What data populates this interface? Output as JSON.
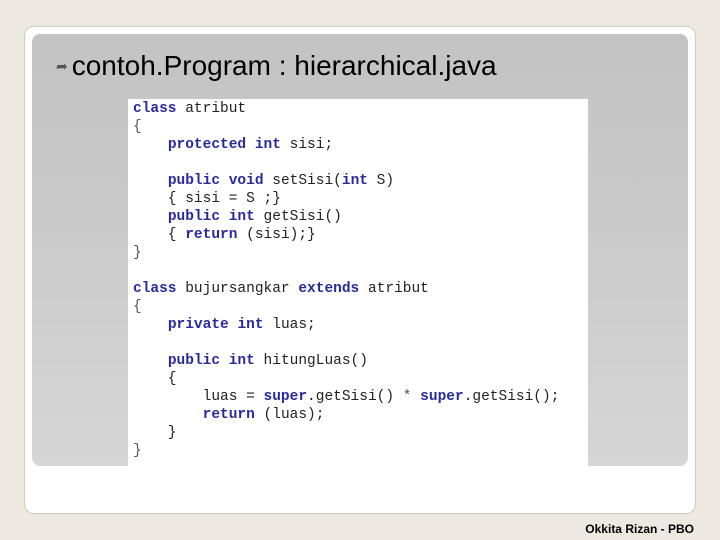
{
  "slide": {
    "title": "contoh.Program : hierarchical.java",
    "bullet_icon": "curved-arrow-bullet-icon",
    "footer": "Okkita Rizan - PBO"
  },
  "code_lines": [
    [
      [
        "kw",
        "class"
      ],
      [
        "plain",
        " atribut"
      ]
    ],
    [
      [
        "punct",
        "{"
      ]
    ],
    [
      [
        "plain",
        "    "
      ],
      [
        "kw",
        "protected"
      ],
      [
        "plain",
        " "
      ],
      [
        "kw",
        "int"
      ],
      [
        "plain",
        " sisi;"
      ]
    ],
    [],
    [
      [
        "plain",
        "    "
      ],
      [
        "kw",
        "public"
      ],
      [
        "plain",
        " "
      ],
      [
        "kw",
        "void"
      ],
      [
        "plain",
        " setSisi("
      ],
      [
        "kw",
        "int"
      ],
      [
        "plain",
        " S)"
      ]
    ],
    [
      [
        "plain",
        "    { sisi = S ;}"
      ]
    ],
    [
      [
        "plain",
        "    "
      ],
      [
        "kw",
        "public"
      ],
      [
        "plain",
        " "
      ],
      [
        "kw",
        "int"
      ],
      [
        "plain",
        " getSisi()"
      ]
    ],
    [
      [
        "plain",
        "    { "
      ],
      [
        "kw",
        "return"
      ],
      [
        "plain",
        " (sisi);}"
      ]
    ],
    [
      [
        "punct",
        "}"
      ]
    ],
    [],
    [
      [
        "kw",
        "class"
      ],
      [
        "plain",
        " bujursangkar "
      ],
      [
        "kw",
        "extends"
      ],
      [
        "plain",
        " atribut"
      ]
    ],
    [
      [
        "punct",
        "{"
      ]
    ],
    [
      [
        "plain",
        "    "
      ],
      [
        "kw",
        "private"
      ],
      [
        "plain",
        " "
      ],
      [
        "kw",
        "int"
      ],
      [
        "plain",
        " luas;"
      ]
    ],
    [],
    [
      [
        "plain",
        "    "
      ],
      [
        "kw",
        "public"
      ],
      [
        "plain",
        " "
      ],
      [
        "kw",
        "int"
      ],
      [
        "plain",
        " hitungLuas()"
      ]
    ],
    [
      [
        "plain",
        "    {"
      ]
    ],
    [
      [
        "plain",
        "        luas = "
      ],
      [
        "kw",
        "super"
      ],
      [
        "plain",
        ".getSisi() "
      ],
      [
        "punct",
        "*"
      ],
      [
        "plain",
        " "
      ],
      [
        "kw",
        "super"
      ],
      [
        "plain",
        ".getSisi();"
      ]
    ],
    [
      [
        "plain",
        "        "
      ],
      [
        "kw",
        "return"
      ],
      [
        "plain",
        " (luas);"
      ]
    ],
    [
      [
        "plain",
        "    }"
      ]
    ],
    [
      [
        "punct",
        "}"
      ]
    ]
  ]
}
